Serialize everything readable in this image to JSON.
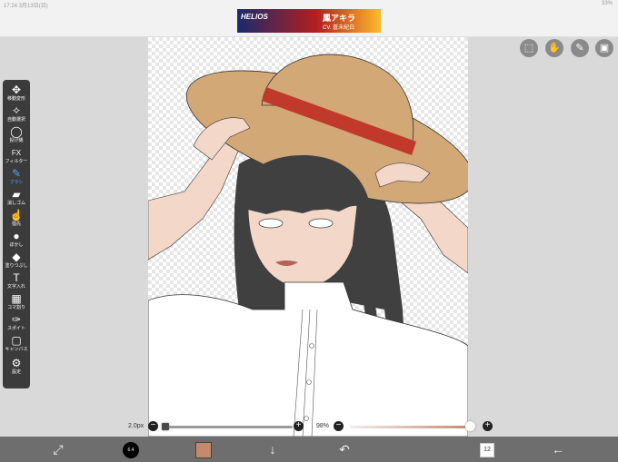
{
  "status_bar": {
    "left": "17:24  3月13日(日)",
    "right": "33%"
  },
  "ad": {
    "line1": "HELIOS",
    "line2": "鳳アキラ",
    "line3": "CV. 蒼未紀白"
  },
  "toolbar": {
    "items": [
      {
        "icon": "move-icon",
        "glyph": "✥",
        "label": "移動変形"
      },
      {
        "icon": "magic-wand-icon",
        "glyph": "✧",
        "label": "自動選択"
      },
      {
        "icon": "lasso-icon",
        "glyph": "◯",
        "label": "投げ縄"
      },
      {
        "icon": "filter-icon",
        "glyph": "FX",
        "label": "フィルター"
      },
      {
        "icon": "brush-icon",
        "glyph": "✎",
        "label": "ブラシ"
      },
      {
        "icon": "eraser-icon",
        "glyph": "▰",
        "label": "消しゴム"
      },
      {
        "icon": "finger-icon",
        "glyph": "☝",
        "label": "指先"
      },
      {
        "icon": "blur-icon",
        "glyph": "●",
        "label": "ぼかし"
      },
      {
        "icon": "fill-icon",
        "glyph": "◆",
        "label": "塗りつぶし"
      },
      {
        "icon": "text-icon",
        "glyph": "T",
        "label": "文字入れ"
      },
      {
        "icon": "frame-divider-icon",
        "glyph": "▦",
        "label": "コマ割り"
      },
      {
        "icon": "eyedropper-icon",
        "glyph": "✑",
        "label": "スポイト"
      },
      {
        "icon": "canvas-icon",
        "glyph": "▢",
        "label": "キャンバス"
      },
      {
        "icon": "settings-icon",
        "glyph": "⚙",
        "label": "設定"
      }
    ],
    "active_index": 4
  },
  "top_right": [
    {
      "icon": "selection-icon",
      "glyph": "⬚"
    },
    {
      "icon": "hand-icon",
      "glyph": "✋"
    },
    {
      "icon": "pen-icon",
      "glyph": "✎"
    },
    {
      "icon": "image-icon",
      "glyph": "▣"
    }
  ],
  "brush_size": {
    "label": "2.0px",
    "minus": "−",
    "plus": "+",
    "level": 0.0
  },
  "opacity": {
    "label": "98%",
    "minus": "−",
    "plus": "+",
    "level": 0.98
  },
  "bottom_bar": {
    "brush_badge": "6.4",
    "color_hex": "#c48a6e",
    "layers_count": "12",
    "items": [
      {
        "icon": "transform-icon",
        "glyph": "⤢"
      },
      {
        "icon": "brush-size-indicator-icon",
        "glyph": ""
      },
      {
        "icon": "color-swatch-icon",
        "glyph": ""
      },
      {
        "icon": "down-arrow-icon",
        "glyph": "↓"
      },
      {
        "icon": "undo-icon",
        "glyph": "↶"
      },
      {
        "icon": "layers-icon",
        "glyph": ""
      },
      {
        "icon": "back-arrow-icon",
        "glyph": "←"
      }
    ]
  },
  "colors": {
    "toolbar_bg": "#3b3b3b",
    "bottombar_bg": "#6e6e6e",
    "accent": "#5aa0ff",
    "hat": "#d2a877",
    "ribbon": "#c0392b",
    "hair": "#404040",
    "skin": "#f3d7c8"
  }
}
